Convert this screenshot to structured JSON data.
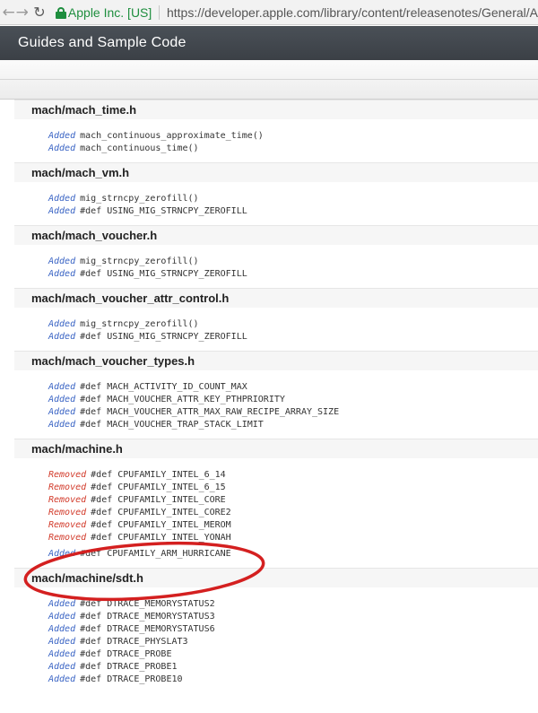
{
  "browser": {
    "site_name": "Apple Inc. [US]",
    "url": "https://developer.apple.com/library/content/releasenotes/General/A"
  },
  "header": {
    "title": "Guides and Sample Code"
  },
  "annotation_color": "#d42020",
  "sections": [
    {
      "title": "mach/mach_time.h",
      "lines": [
        {
          "tag": "Added",
          "code": "mach_continuous_approximate_time()"
        },
        {
          "tag": "Added",
          "code": "mach_continuous_time()"
        }
      ]
    },
    {
      "title": "mach/mach_vm.h",
      "lines": [
        {
          "tag": "Added",
          "code": "mig_strncpy_zerofill()"
        },
        {
          "tag": "Added",
          "code": "#def USING_MIG_STRNCPY_ZEROFILL"
        }
      ]
    },
    {
      "title": "mach/mach_voucher.h",
      "lines": [
        {
          "tag": "Added",
          "code": "mig_strncpy_zerofill()"
        },
        {
          "tag": "Added",
          "code": "#def USING_MIG_STRNCPY_ZEROFILL"
        }
      ]
    },
    {
      "title": "mach/mach_voucher_attr_control.h",
      "lines": [
        {
          "tag": "Added",
          "code": "mig_strncpy_zerofill()"
        },
        {
          "tag": "Added",
          "code": "#def USING_MIG_STRNCPY_ZEROFILL"
        }
      ]
    },
    {
      "title": "mach/mach_voucher_types.h",
      "lines": [
        {
          "tag": "Added",
          "code": "#def MACH_ACTIVITY_ID_COUNT_MAX"
        },
        {
          "tag": "Added",
          "code": "#def MACH_VOUCHER_ATTR_KEY_PTHPRIORITY"
        },
        {
          "tag": "Added",
          "code": "#def MACH_VOUCHER_ATTR_MAX_RAW_RECIPE_ARRAY_SIZE"
        },
        {
          "tag": "Added",
          "code": "#def MACH_VOUCHER_TRAP_STACK_LIMIT"
        }
      ]
    },
    {
      "title": "mach/machine.h",
      "lines": [
        {
          "tag": "Removed",
          "code": "#def CPUFAMILY_INTEL_6_14"
        },
        {
          "tag": "Removed",
          "code": "#def CPUFAMILY_INTEL_6_15"
        },
        {
          "tag": "Removed",
          "code": "#def CPUFAMILY_INTEL_CORE"
        },
        {
          "tag": "Removed",
          "code": "#def CPUFAMILY_INTEL_CORE2"
        },
        {
          "tag": "Removed",
          "code": "#def CPUFAMILY_INTEL_MEROM"
        },
        {
          "tag": "Removed",
          "code": "#def CPUFAMILY_INTEL_YONAH"
        },
        {
          "tag": "Added",
          "code": "#def CPUFAMILY_ARM_HURRICANE",
          "highlight": true
        }
      ]
    },
    {
      "title": "mach/machine/sdt.h",
      "lines": [
        {
          "tag": "Added",
          "code": "#def DTRACE_MEMORYSTATUS2"
        },
        {
          "tag": "Added",
          "code": "#def DTRACE_MEMORYSTATUS3"
        },
        {
          "tag": "Added",
          "code": "#def DTRACE_MEMORYSTATUS6"
        },
        {
          "tag": "Added",
          "code": "#def DTRACE_PHYSLAT3"
        },
        {
          "tag": "Added",
          "code": "#def DTRACE_PROBE"
        },
        {
          "tag": "Added",
          "code": "#def DTRACE_PROBE1"
        },
        {
          "tag": "Added",
          "code": "#def DTRACE_PROBE10"
        }
      ]
    }
  ]
}
